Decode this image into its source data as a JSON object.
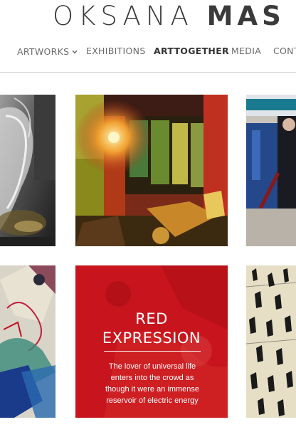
{
  "header": {
    "title_first": "OKSANA",
    "title_last": "MAS"
  },
  "nav": {
    "items": [
      {
        "label": "ARTWORKS",
        "has_dropdown": true
      },
      {
        "label": "EXHIBITIONS"
      },
      {
        "label": "ARTTOGETHER",
        "active": true
      },
      {
        "label": "MEDIA"
      },
      {
        "label": "CONT"
      }
    ]
  },
  "gallery": {
    "featured": {
      "title_line1": "RED",
      "title_line2": "EXPRESSION",
      "description": "The lover of universal life enters into the crowd as though it were an immense reservoir of electric energy"
    }
  },
  "colors": {
    "text_dark": "#333333",
    "text_nav": "#6a6a6a",
    "accent_red": "#c8141c",
    "rule": "#cfcfcf"
  },
  "icons": {
    "dropdown": "chevron-down-icon"
  }
}
